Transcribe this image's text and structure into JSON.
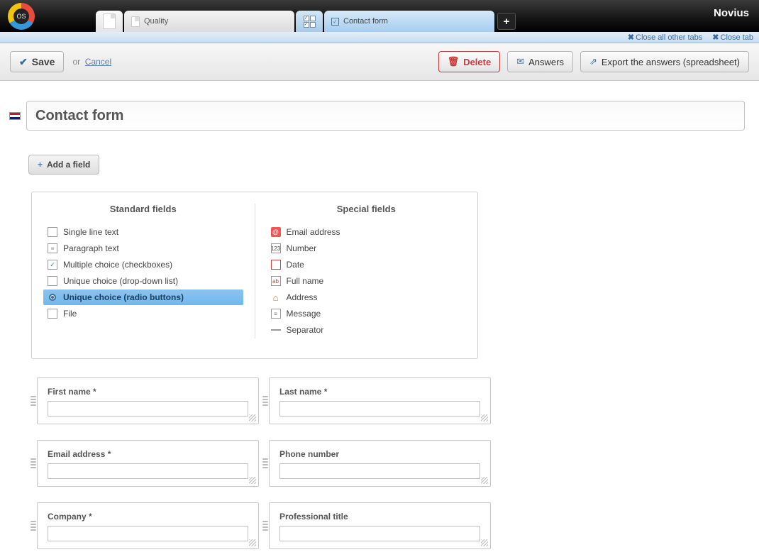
{
  "brand": "Novius",
  "tabs": {
    "quality": "Quality",
    "active": "Contact form"
  },
  "subbar": {
    "close_all": "Close all other tabs",
    "close_tab": "Close tab"
  },
  "actions": {
    "save": "Save",
    "or": "or",
    "cancel": "Cancel",
    "delete": "Delete",
    "answers": "Answers",
    "export": "Export the answers (spreadsheet)"
  },
  "title": "Contact form",
  "add_field": "Add a field",
  "panel": {
    "standard_heading": "Standard fields",
    "special_heading": "Special fields",
    "standard": [
      "Single line text",
      "Paragraph text",
      "Multiple choice (checkboxes)",
      "Unique choice (drop-down list)",
      "Unique choice (radio buttons)",
      "File"
    ],
    "special": [
      "Email address",
      "Number",
      "Date",
      "Full name",
      "Address",
      "Message",
      "Separator"
    ]
  },
  "rows": [
    {
      "left": "First name *",
      "right": "Last name *"
    },
    {
      "left": "Email address *",
      "right": "Phone number"
    },
    {
      "left": "Company *",
      "right": "Professional title"
    }
  ]
}
